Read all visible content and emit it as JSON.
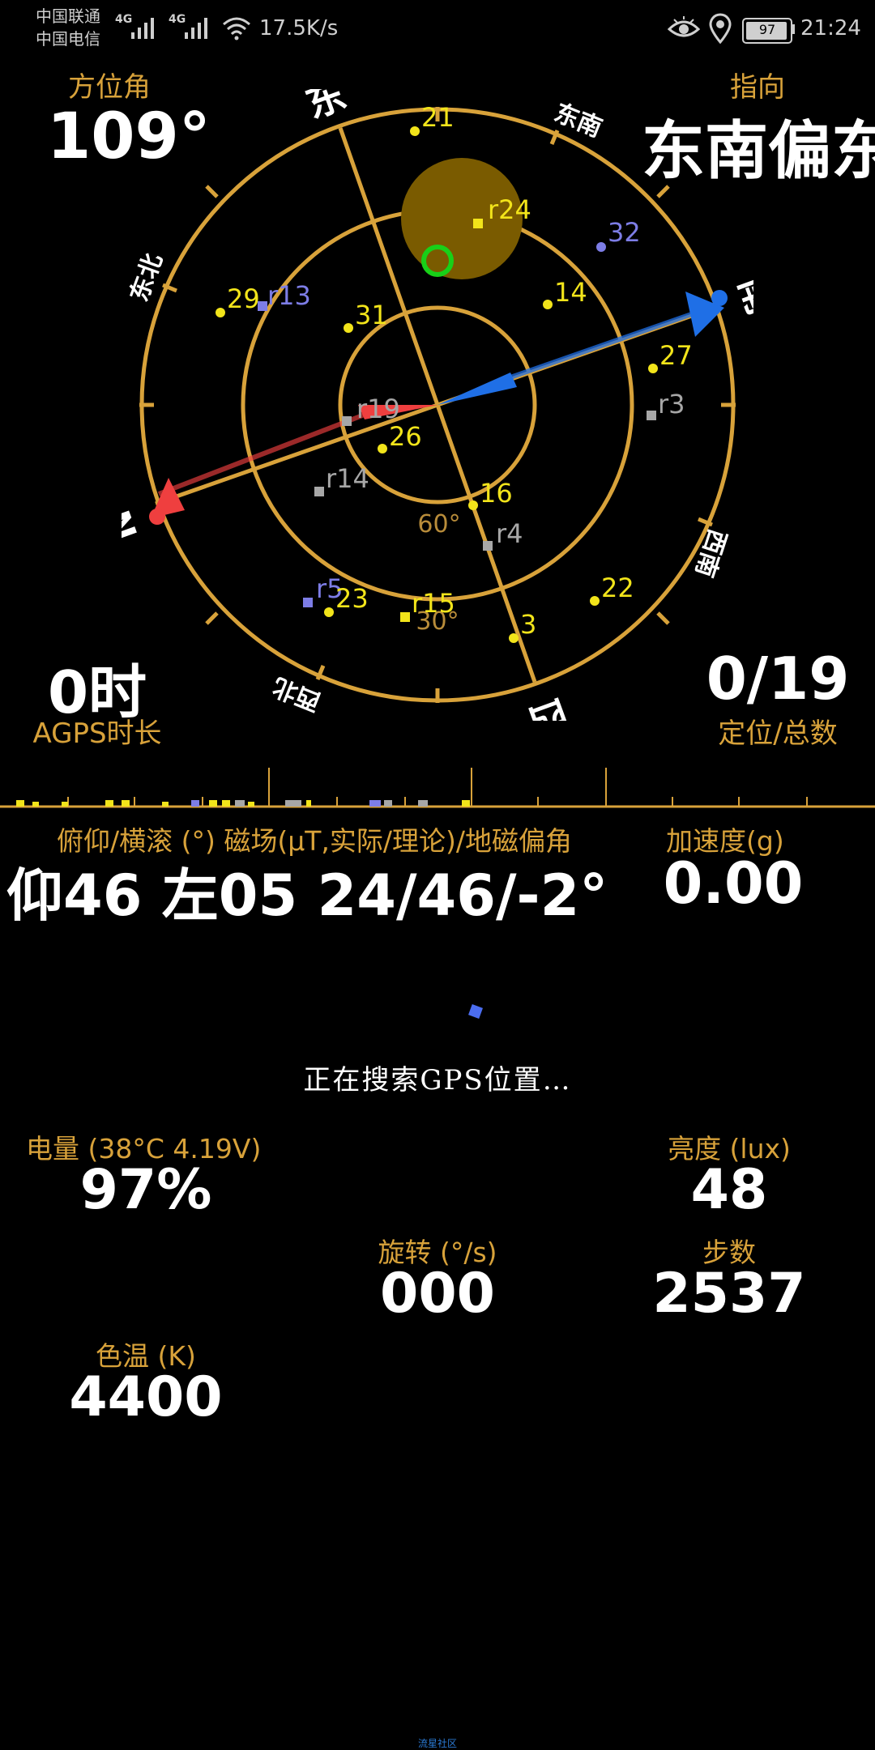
{
  "status_bar": {
    "carrier1": "中国联通",
    "carrier2": "中国电信",
    "net1": "4G",
    "net2": "4G",
    "speed": "17.5K/s",
    "battery": "97",
    "time": "21:24",
    "icons": [
      "eye-icon",
      "location-icon",
      "battery-icon",
      "wifi-icon",
      "signal-icon"
    ]
  },
  "header": {
    "azimuth_label": "方位角",
    "azimuth_value": "109°",
    "direction_label": "指向",
    "direction_value": "东南偏东"
  },
  "compass": {
    "dirs": {
      "east": "东",
      "southeast": "东南",
      "south": "南",
      "southwest": "西南",
      "west": "西",
      "northwest": "西北",
      "north": "N",
      "northeast": "东北"
    },
    "ring_labels": {
      "inner": "60°",
      "outer": "30°"
    },
    "satellites": [
      "21",
      "r24",
      "32",
      "29",
      "r13",
      "14",
      "31",
      "27",
      "r19",
      "r3",
      "26",
      "r14",
      "16",
      "r4",
      "r5",
      "23",
      "r15",
      "22",
      "3"
    ],
    "colors": {
      "ring": "#d8a23a",
      "yellow": "#f2e41a",
      "blue": "#7d7de6",
      "gray": "#a7a7a7",
      "needle_blue": "#1f6fe6",
      "needle_red": "#ef3f3f",
      "sun": "#7a5b00",
      "green": "#18d018"
    }
  },
  "left_stats": {
    "agps_value": "0时",
    "agps_label": "AGPS时长"
  },
  "right_stats": {
    "fix_value": "0/19",
    "fix_label": "定位/总数"
  },
  "sensors": {
    "tilt_label": "俯仰/横滚 (°) 磁场(μT,实际/理论)/地磁偏角",
    "tilt_value": "仰46 左05 24/46/-2°",
    "accel_label": "加速度(g)",
    "accel_value": "0.00"
  },
  "gps_search": "正在搜索GPS位置…",
  "bottom": {
    "battery_label": "电量 (38°C 4.19V)",
    "battery_value": "97%",
    "brightness_label": "亮度 (lux)",
    "brightness_value": "48",
    "rotation_label": "旋转 (°/s)",
    "rotation_value": "000",
    "steps_label": "步数",
    "steps_value": "2537",
    "color_temp_label": "色温 (K)",
    "color_temp_value": "4400"
  },
  "footer": {
    "text": "流星社区"
  }
}
